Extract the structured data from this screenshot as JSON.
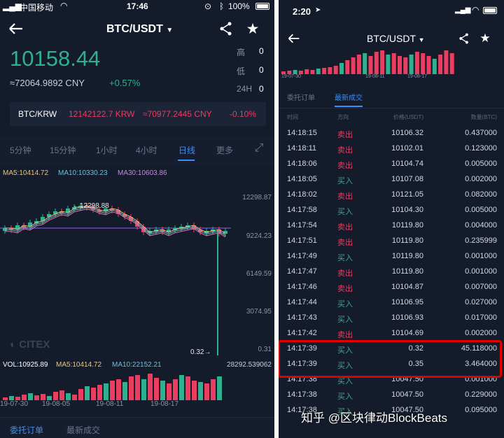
{
  "left": {
    "status": {
      "carrier": "中国移动",
      "time": "17:46",
      "battery": "100%"
    },
    "title": "BTC/USDT",
    "price": "10158.44",
    "cny": "≈72064.9892 CNY",
    "change": "+0.57%",
    "stats": [
      {
        "label": "高",
        "value": "0"
      },
      {
        "label": "低",
        "value": "0"
      },
      {
        "label": "24H",
        "value": "0"
      }
    ],
    "krw": {
      "pair": "BTC/KRW",
      "price": "12142122.7 KRW",
      "cny": "≈70977.2445 CNY",
      "change": "-0.10%"
    },
    "tabs": [
      "5分钟",
      "15分钟",
      "1小时",
      "4小时",
      "日线",
      "更多"
    ],
    "active_tab": 4,
    "ma": {
      "ma5": "MA5:10414.72",
      "ma10": "MA10:10330.23",
      "ma30": "MA30:10603.86"
    },
    "axis": [
      "12298.87",
      "9224.23",
      "6149.59",
      "3074.95",
      "0.31"
    ],
    "high_label": "12298.88",
    "low_label": "0.32",
    "watermark": "CITEX",
    "vol": {
      "vol": "VOL:10925.89",
      "ma5": "MA5:10414.72",
      "ma10": "MA10:22152.21",
      "max": "28292.539062"
    },
    "dates": [
      "19-07-30",
      "19-08-05",
      "19-08-11",
      "19-08-17"
    ],
    "bottom_tabs": [
      "委托订单",
      "最新成交"
    ],
    "colors": {
      "up": "#2fb08e",
      "down": "#ea3d5f",
      "accent": "#3d8ef2",
      "bg": "#141b2b"
    }
  },
  "right": {
    "status": {
      "time": "2:20"
    },
    "title": "BTC/USDT",
    "mini_dates": [
      "19-07-30",
      "19-08-11",
      "19-08-17"
    ],
    "tabs": [
      "委托订单",
      "最新成交"
    ],
    "active_tab": 1,
    "headers": [
      "时间",
      "方向",
      "价格(USDT)",
      "数量(BTC)"
    ],
    "trades": [
      {
        "time": "14:18:15",
        "dir": "卖出",
        "side": "sell",
        "price": "10106.32",
        "amount": "0.437000"
      },
      {
        "time": "14:18:11",
        "dir": "卖出",
        "side": "sell",
        "price": "10102.01",
        "amount": "0.123000"
      },
      {
        "time": "14:18:06",
        "dir": "卖出",
        "side": "sell",
        "price": "10104.74",
        "amount": "0.005000"
      },
      {
        "time": "14:18:05",
        "dir": "买入",
        "side": "buy",
        "price": "10107.08",
        "amount": "0.002000"
      },
      {
        "time": "14:18:02",
        "dir": "卖出",
        "side": "sell",
        "price": "10121.05",
        "amount": "0.082000"
      },
      {
        "time": "14:17:58",
        "dir": "买入",
        "side": "buy",
        "price": "10104.30",
        "amount": "0.005000"
      },
      {
        "time": "14:17:54",
        "dir": "卖出",
        "side": "sell",
        "price": "10119.80",
        "amount": "0.004000"
      },
      {
        "time": "14:17:51",
        "dir": "卖出",
        "side": "sell",
        "price": "10119.80",
        "amount": "0.235999"
      },
      {
        "time": "14:17:49",
        "dir": "买入",
        "side": "buy",
        "price": "10119.80",
        "amount": "0.001000"
      },
      {
        "time": "14:17:47",
        "dir": "卖出",
        "side": "sell",
        "price": "10119.80",
        "amount": "0.001000"
      },
      {
        "time": "14:17:46",
        "dir": "卖出",
        "side": "sell",
        "price": "10104.87",
        "amount": "0.007000"
      },
      {
        "time": "14:17:44",
        "dir": "买入",
        "side": "buy",
        "price": "10106.95",
        "amount": "0.027000"
      },
      {
        "time": "14:17:43",
        "dir": "买入",
        "side": "buy",
        "price": "10106.93",
        "amount": "0.017000"
      },
      {
        "time": "14:17:42",
        "dir": "卖出",
        "side": "sell",
        "price": "10104.69",
        "amount": "0.002000"
      },
      {
        "time": "14:17:39",
        "dir": "买入",
        "side": "buy",
        "price": "0.32",
        "amount": "45.118000"
      },
      {
        "time": "14:17:39",
        "dir": "买入",
        "side": "buy",
        "price": "0.35",
        "amount": "3.464000"
      },
      {
        "time": "14:17:38",
        "dir": "买入",
        "side": "buy",
        "price": "10047.50",
        "amount": "0.001000"
      },
      {
        "time": "14:17:38",
        "dir": "买入",
        "side": "buy",
        "price": "10047.50",
        "amount": "0.229000"
      },
      {
        "time": "14:17:38",
        "dir": "买入",
        "side": "buy",
        "price": "10047.50",
        "amount": "0.095000"
      }
    ],
    "highlight_rows": [
      14,
      15
    ],
    "highlight_color": "#e00000"
  },
  "watermark_text": "知乎 @区块律动BlockBeats"
}
